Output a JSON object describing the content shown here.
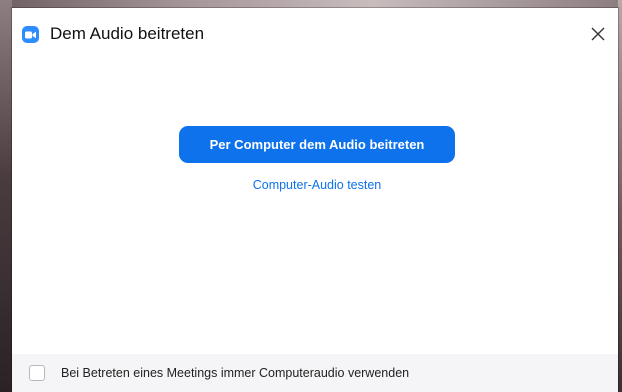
{
  "window": {
    "title": "Dem Audio beitreten",
    "app_icon": "zoom-camera-icon",
    "close_icon": "close-icon",
    "accent_color": "#0e72ed"
  },
  "main": {
    "join_button_label": "Per Computer dem Audio beitreten",
    "test_audio_link": "Computer-Audio testen"
  },
  "footer": {
    "checkbox_label": "Bei Betreten eines Meetings immer Computeraudio verwenden",
    "checkbox_checked": false
  }
}
